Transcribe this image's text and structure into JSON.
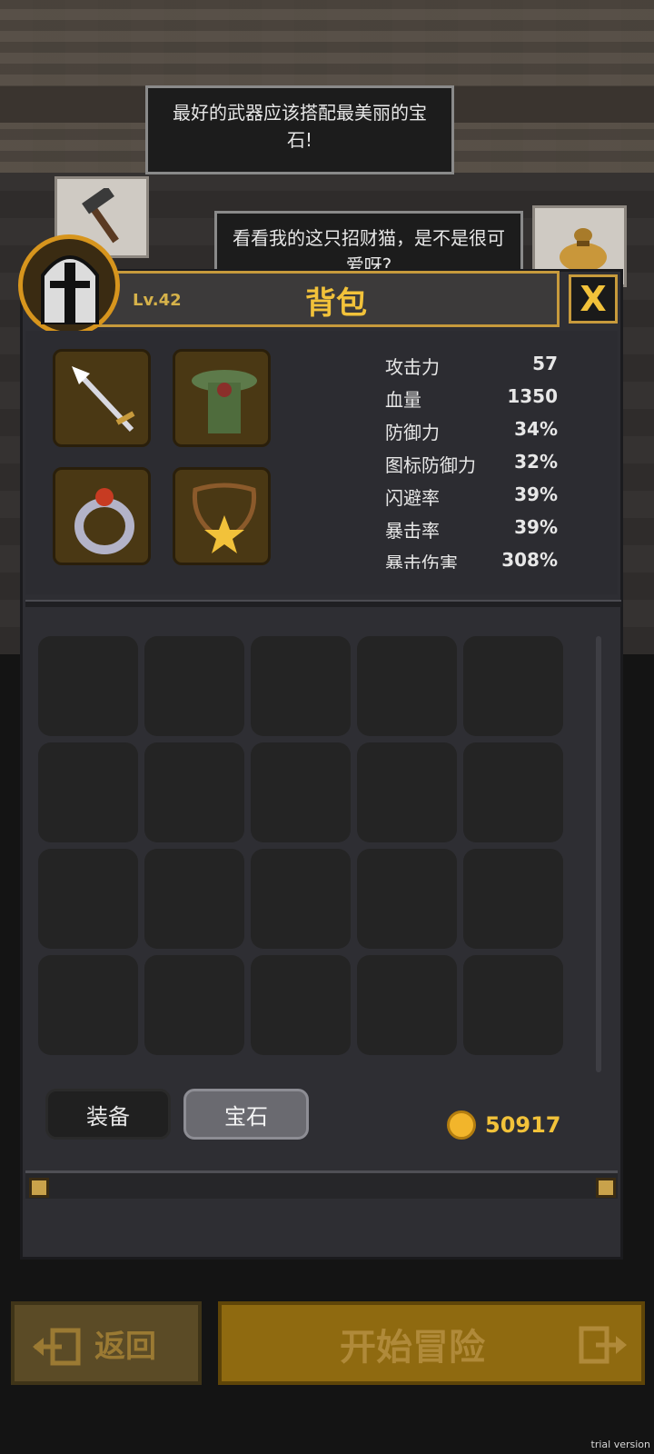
{
  "speech": {
    "line1": "最好的武器应该搭配最美丽的宝石!",
    "line2": "看看我的这只招财猫，是不是很可爱呀?"
  },
  "header": {
    "level": "Lv.42",
    "title": "背包",
    "close_label": "X"
  },
  "stats": [
    {
      "label": "攻击力",
      "value": "57"
    },
    {
      "label": "血量",
      "value": "1350"
    },
    {
      "label": "防御力",
      "value": "34%"
    },
    {
      "label": "图标防御力",
      "value": "32%"
    },
    {
      "label": "闪避率",
      "value": "39%"
    },
    {
      "label": "暴击率",
      "value": "39%"
    },
    {
      "label": "暴击伤害",
      "value": "308%"
    }
  ],
  "equipment": {
    "weapon_icon": "spear-icon",
    "armor_icon": "hooded-cloak-icon",
    "ring_icon": "ruby-ring-icon",
    "necklace_icon": "star-necklace-icon"
  },
  "inventory": {
    "rows": 4,
    "cols": 5
  },
  "tabs": {
    "equip": "装备",
    "gem": "宝石",
    "active": "gem"
  },
  "gold": "50917",
  "buttons": {
    "back": "返回",
    "start": "开始冒险"
  },
  "watermark": "trial version",
  "colors": {
    "accent_gold": "#f2c23a",
    "panel": "#2e2e33",
    "slot_brown": "#4a3814",
    "start_button": "#8f6a10"
  }
}
